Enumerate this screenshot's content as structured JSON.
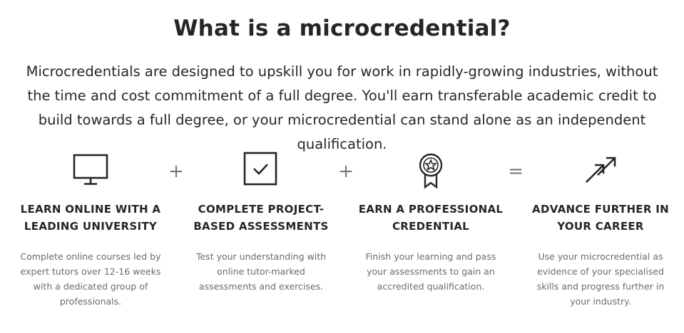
{
  "heading": "What is a microcredential?",
  "intro": "Microcredentials are designed to upskill you for work in rapidly-growing industries, without the time and cost commitment of a full degree. You'll earn transferable academic credit to build towards a full degree, or your microcredential can stand alone as an independent qualification.",
  "steps": [
    {
      "icon": "monitor-icon",
      "title": "Learn online with a leading university",
      "desc": "Complete online courses led by expert tutors over 12-16 weeks with a dedicated group of professionals."
    },
    {
      "icon": "checkbox-icon",
      "title": "Complete project-based assessments",
      "desc": "Test your understanding with online tutor-marked assessments and exercises."
    },
    {
      "icon": "award-ribbon-icon",
      "title": "Earn a professional credential",
      "desc": "Finish your learning and pass your assessments to gain an accredited qualification."
    },
    {
      "icon": "trending-arrows-icon",
      "title": "Advance further in your career",
      "desc": "Use your microcredential as evidence of your specialised skills and progress further in your industry."
    }
  ],
  "operators": [
    "+",
    "+",
    "="
  ],
  "colors": {
    "text": "#262626",
    "muted": "#6b6b6b",
    "operator": "#777777"
  }
}
